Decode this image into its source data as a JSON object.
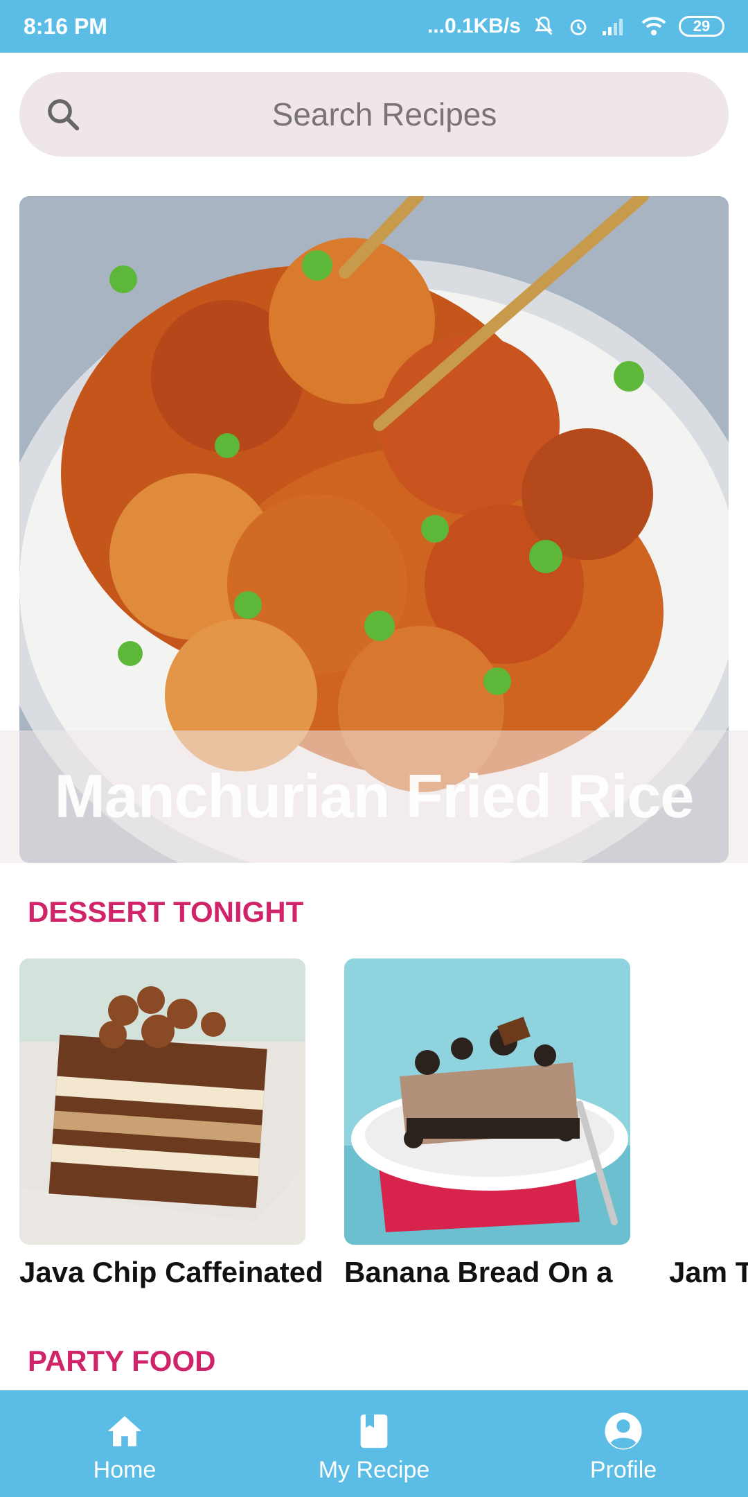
{
  "status_bar": {
    "time": "8:16 PM",
    "network_speed": "...0.1KB/s",
    "battery": "29"
  },
  "search": {
    "placeholder": "Search Recipes"
  },
  "featured": {
    "title": "Manchurian Fried Rice"
  },
  "sections": {
    "dessert_title": "DESSERT TONIGHT",
    "party_title": "PARTY FOOD"
  },
  "dessert_cards": [
    {
      "title": "Java Chip Caffeinated"
    },
    {
      "title": "Banana Bread On a"
    },
    {
      "title": "Jam Ta"
    }
  ],
  "bottom_nav": {
    "items": [
      {
        "label": "Home",
        "icon": "home-icon"
      },
      {
        "label": "My Recipe",
        "icon": "book-icon"
      },
      {
        "label": "Profile",
        "icon": "account-icon"
      }
    ]
  },
  "colors": {
    "accent": "#5bbde6",
    "section_title": "#d0246a",
    "search_bg": "#efe7e7"
  }
}
